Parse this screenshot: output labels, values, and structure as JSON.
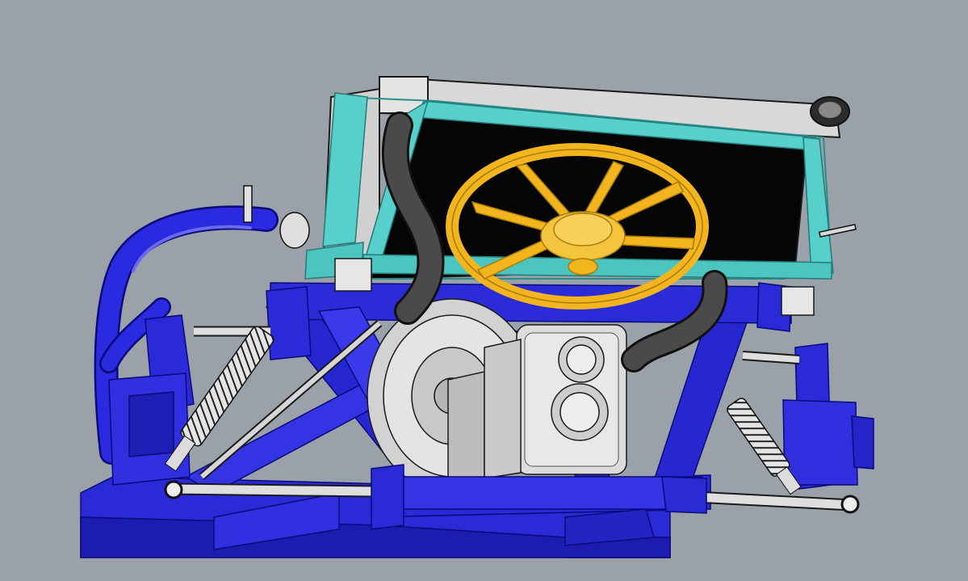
{
  "viewport": {
    "background": "#9aa1a9",
    "model": "chassis-assembly"
  },
  "colors": {
    "chassis_frame": "#2323c8",
    "chassis_edge": "#0a0a7a",
    "radiator_frame": "#4fc9c4",
    "radiator_core": "#050505",
    "radiator_tank": "#dcdcdc",
    "fan": "#f2b51e",
    "hose": "#3a3a3a",
    "engine": "#d6d6d6",
    "linework": "#1a1a1a"
  },
  "icons": [
    "radiator-cap-icon",
    "fan-hub-icon",
    "suspension-spring-icon",
    "rod-end-icon"
  ]
}
